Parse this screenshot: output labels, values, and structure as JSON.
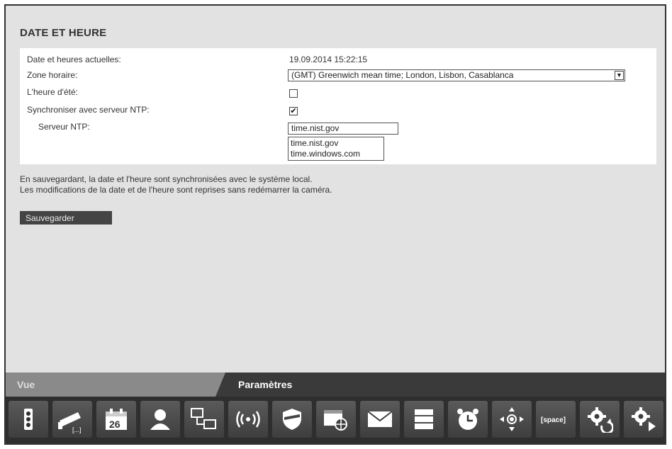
{
  "section_title": "DATE ET HEURE",
  "fields": {
    "current_datetime_label": "Date et heures actuelles:",
    "current_datetime_value": "19.09.2014 15:22:15",
    "timezone_label": "Zone horaire:",
    "timezone_value": "(GMT) Greenwich mean time; London, Lisbon, Casablanca",
    "dst_label": "L'heure d'été:",
    "dst_checked": false,
    "ntp_sync_label": "Synchroniser avec serveur NTP:",
    "ntp_sync_checked": true,
    "ntp_server_label": "Serveur NTP:",
    "ntp_server_value": "time.nist.gov",
    "ntp_options": [
      "time.nist.gov",
      "time.windows.com"
    ]
  },
  "info": {
    "line1": "En sauvegardant, la date et l'heure sont synchronisées avec le système local.",
    "line2": "Les modifications de la date et de l'heure sont reprises sans redémarrer la caméra."
  },
  "save_button": "Sauvegarder",
  "tabs": {
    "vue": "Vue",
    "parametres": "Paramètres"
  },
  "toolbar": {
    "date_badge": "26",
    "space_badge": "[space]",
    "tools": [
      "traffic-light-icon",
      "camera-icon",
      "calendar-icon",
      "user-icon",
      "network-icon",
      "wireless-icon",
      "shield-icon",
      "browser-globe-icon",
      "mail-icon",
      "storage-icon",
      "alarm-clock-icon",
      "ptz-move-icon",
      "space-icon",
      "gear-refresh-icon",
      "gear-play-icon"
    ]
  }
}
